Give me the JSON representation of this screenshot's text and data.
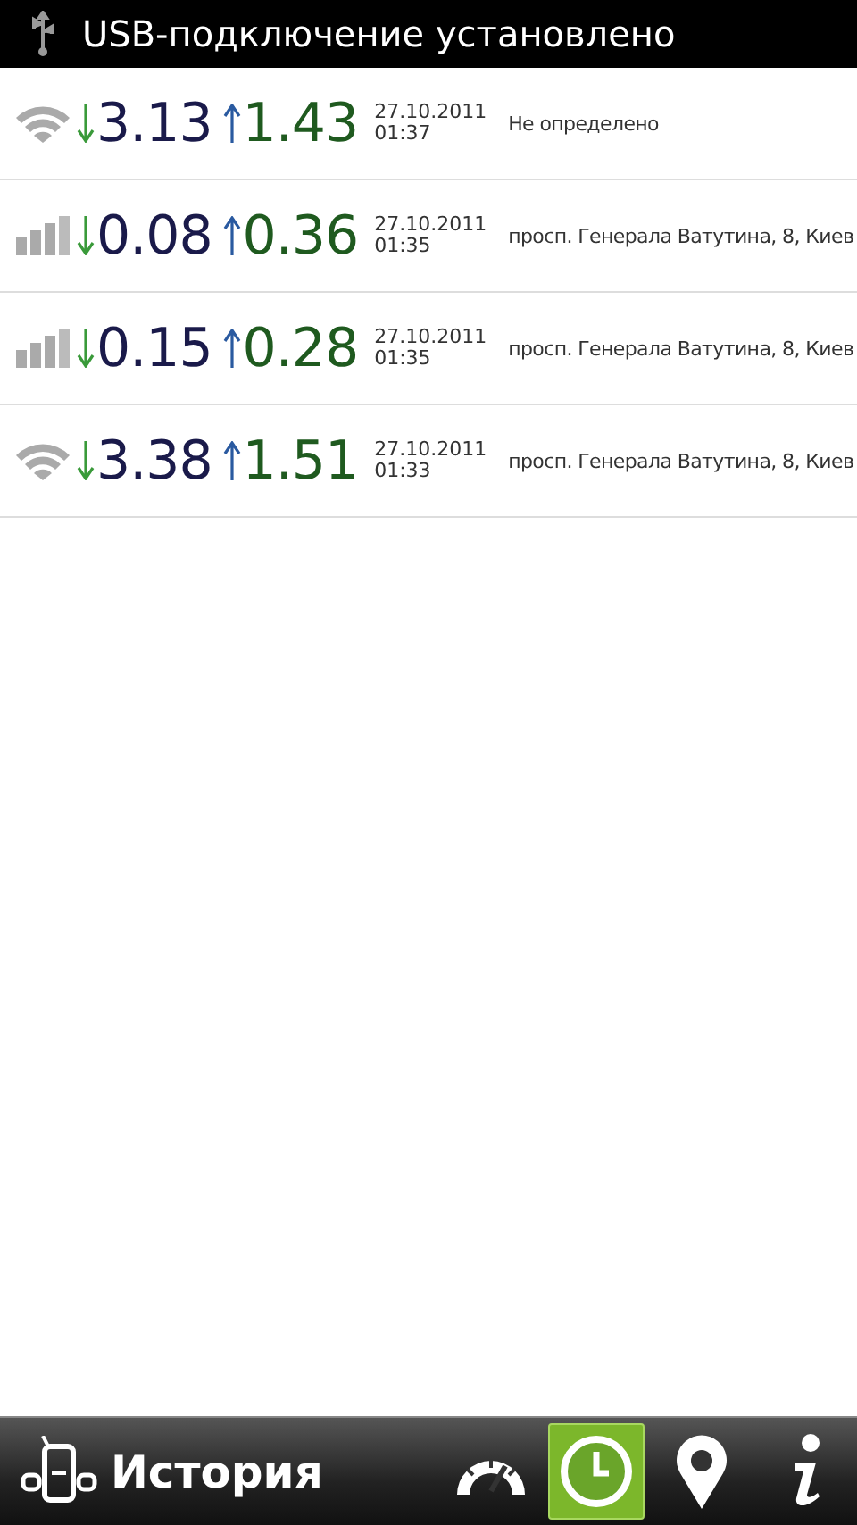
{
  "status_bar": {
    "notification": "USB-подключение установлено"
  },
  "rows": [
    {
      "kind": "wifi",
      "download": "3.13",
      "upload": "1.43",
      "date": "27.10.2011",
      "time": "01:37",
      "location": "Не определено"
    },
    {
      "kind": "cellular",
      "download": "0.08",
      "upload": "0.36",
      "date": "27.10.2011",
      "time": "01:35",
      "location": "просп. Генерала Ватутина, 8, Киев"
    },
    {
      "kind": "cellular",
      "download": "0.15",
      "upload": "0.28",
      "date": "27.10.2011",
      "time": "01:35",
      "location": "просп. Генерала Ватутина, 8, Киев"
    },
    {
      "kind": "wifi",
      "download": "3.38",
      "upload": "1.51",
      "date": "27.10.2011",
      "time": "01:33",
      "location": "просп. Генерала Ватутина, 8, Киев"
    }
  ],
  "bottom_bar": {
    "title": "История",
    "tabs": [
      {
        "kind": "speed",
        "selected": false
      },
      {
        "kind": "history",
        "selected": true
      },
      {
        "kind": "map",
        "selected": false
      },
      {
        "kind": "info",
        "selected": false
      }
    ]
  }
}
